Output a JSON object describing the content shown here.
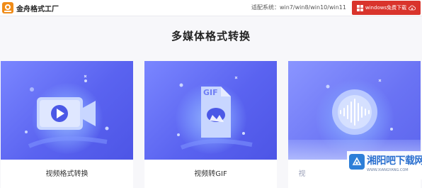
{
  "header": {
    "brand": "金舟格式工厂",
    "compat_label": "适配系统：win7/win8/win10/win11",
    "download_label": "windows免费下载"
  },
  "main": {
    "title": "多媒体格式转换",
    "cards": [
      {
        "label": "视频格式转换",
        "icon": "video-play-icon"
      },
      {
        "label": "视频转GIF",
        "icon": "gif-file-icon",
        "badge": "GIF"
      },
      {
        "label": "视",
        "icon": "audio-wave-icon"
      }
    ]
  },
  "watermark": {
    "logo": "xiangyangbar-logo",
    "name": "湘阳吧下载网",
    "url": "WWW.XIANGYANG.COM"
  },
  "colors": {
    "accent": "#5a63f0",
    "download_button": "#d9342c",
    "card_background": "#ffffff",
    "page_background": "#f7f7fa"
  }
}
